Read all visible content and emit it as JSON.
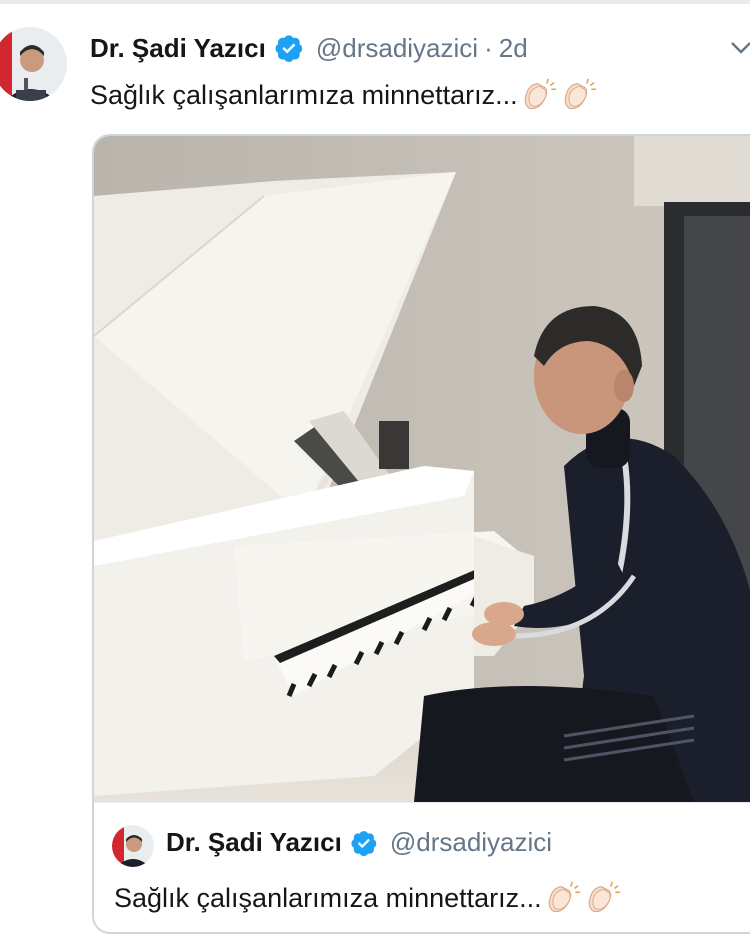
{
  "tweet": {
    "display_name": "Dr. Şadi Yazıcı",
    "handle": "@drsadiyazici",
    "separator": "·",
    "time": "2d",
    "text": "Sağlık çalışanlarımıza minnettarız..."
  },
  "quoted_tweet": {
    "display_name": "Dr. Şadi Yazıcı",
    "handle": "@drsadiyazici",
    "text": "Sağlık çalışanlarımıza minnettarız..."
  },
  "icons": {
    "verified": "verified-badge-icon",
    "clap": "clapping-hands-icon",
    "more": "chevron-down-icon"
  },
  "colors": {
    "verified_blue": "#1da1f2",
    "muted_text": "#657786",
    "border": "#ccd6dd"
  }
}
